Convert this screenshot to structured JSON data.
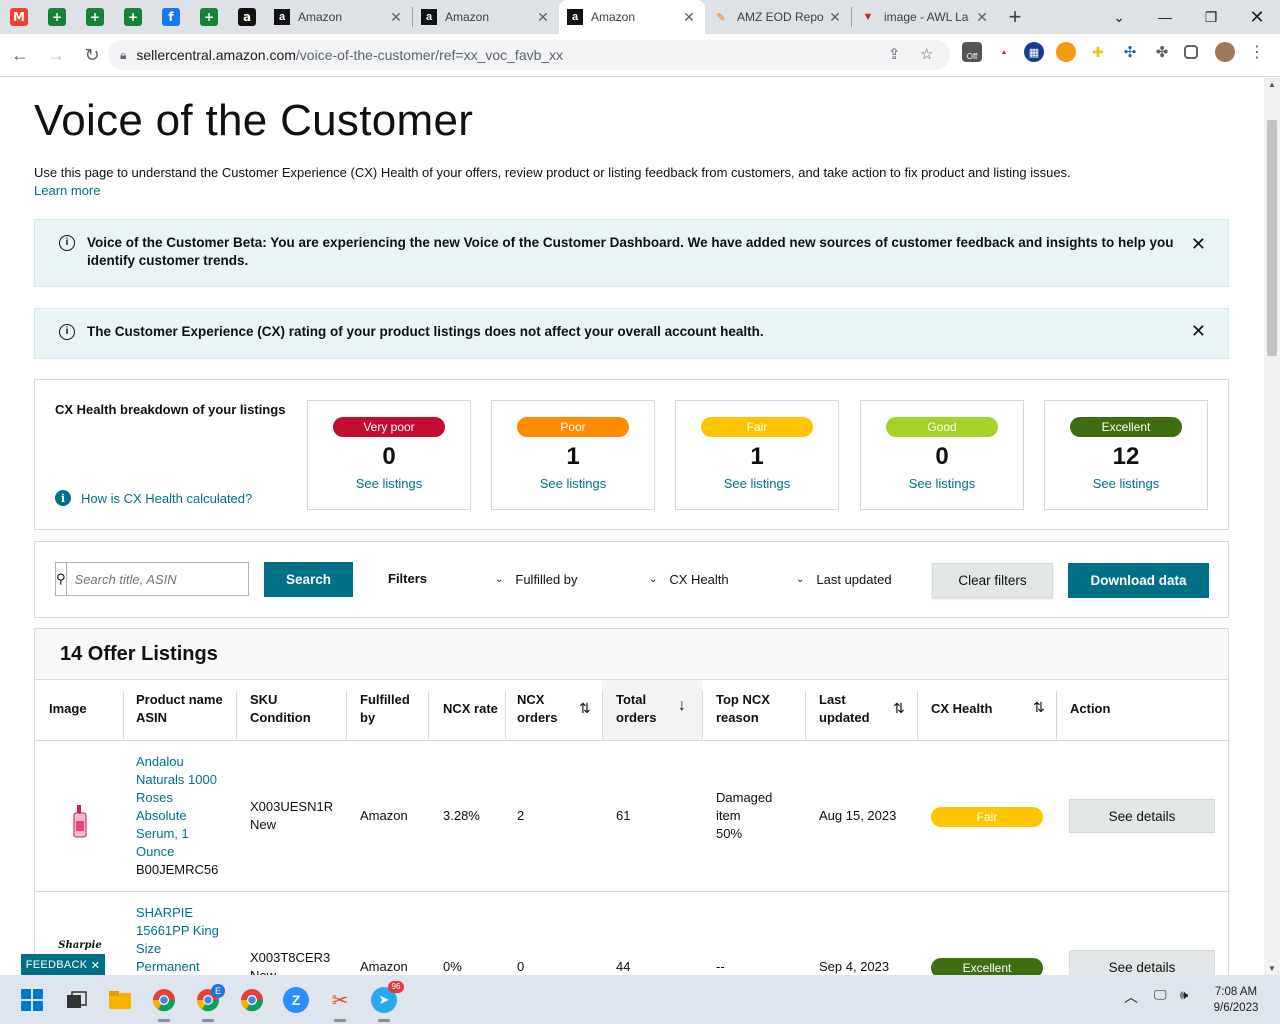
{
  "browser": {
    "pinned_tabs": [
      {
        "name": "gmail-icon",
        "glyph": "M",
        "color": "#ea4335"
      },
      {
        "name": "sheets-icon",
        "glyph": "+",
        "color": "#188038"
      },
      {
        "name": "sheets-icon",
        "glyph": "+",
        "color": "#188038"
      },
      {
        "name": "sheets-icon",
        "glyph": "+",
        "color": "#188038"
      },
      {
        "name": "facebook-icon",
        "glyph": "f",
        "color": "#1877f2"
      },
      {
        "name": "sheets-icon",
        "glyph": "+",
        "color": "#188038"
      },
      {
        "name": "amazon-icon",
        "glyph": "a",
        "color": "#111111"
      }
    ],
    "tabs": [
      {
        "title": "Amazon",
        "active": false
      },
      {
        "title": "Amazon",
        "active": false
      },
      {
        "title": "Amazon",
        "active": true
      },
      {
        "title": "AMZ EOD Repo",
        "active": false
      },
      {
        "title": "image - AWL La",
        "active": false
      }
    ],
    "url_host": "sellercentral.amazon.com",
    "url_path": "/voice-of-the-customer/ref=xx_voc_favb_xx",
    "ext_badge": "Off"
  },
  "page": {
    "title": "Voice of the Customer",
    "description": "Use this page to understand the Customer Experience (CX) Health of your offers, review product or listing feedback from customers, and take action to fix product and listing issues.",
    "learn_more": "Learn more",
    "alert_beta": "Voice of the Customer Beta: You are experiencing the new Voice of the Customer Dashboard. We have added new sources of customer feedback and insights to help you identify customer trends.",
    "alert_rating": "The Customer Experience (CX) rating of your product listings does not affect your overall account health."
  },
  "cx_health": {
    "title": "CX Health breakdown of your listings",
    "help_link": "How is CX Health calculated?",
    "cards": [
      {
        "label": "Very poor",
        "count": "0",
        "link": "See listings",
        "color": "#c40c33",
        "text": "#ffffff"
      },
      {
        "label": "Poor",
        "count": "1",
        "link": "See listings",
        "color": "#ff8c00",
        "text": "#ffffff"
      },
      {
        "label": "Fair",
        "count": "1",
        "link": "See listings",
        "color": "#ffc400",
        "text": "#ffffff"
      },
      {
        "label": "Good",
        "count": "0",
        "link": "See listings",
        "color": "#a4d22a",
        "text": "#ffffff"
      },
      {
        "label": "Excellent",
        "count": "12",
        "link": "See listings",
        "color": "#3f6d12",
        "text": "#ffffff"
      }
    ]
  },
  "filters": {
    "search_placeholder": "Search title, ASIN",
    "search_button": "Search",
    "filters_label": "Filters",
    "fulfilled_by": "Fulfilled by",
    "cx_health": "CX Health",
    "last_updated": "Last updated",
    "clear": "Clear filters",
    "download": "Download data"
  },
  "listings": {
    "heading": "14 Offer Listings",
    "columns": {
      "image": "Image",
      "product_1": "Product name",
      "product_2": "ASIN",
      "sku_1": "SKU",
      "sku_2": "Condition",
      "fulfilled_1": "Fulfilled",
      "fulfilled_2": "by",
      "ncx_rate": "NCX rate",
      "ncx_orders_1": "NCX",
      "ncx_orders_2": "orders",
      "total_1": "Total",
      "total_2": "orders",
      "top_1": "Top NCX",
      "top_2": "reason",
      "last_1": "Last",
      "last_2": "updated",
      "cx_health": "CX Health",
      "action": "Action"
    },
    "rows": [
      {
        "product_lines": [
          "Andalou",
          "Naturals 1000",
          "Roses",
          "Absolute",
          "Serum, 1",
          "Ounce"
        ],
        "asin": "B00JEMRC56",
        "sku": "X003UESN1R",
        "condition": "New",
        "fulfilled": "Amazon",
        "ncx_rate": "3.28%",
        "ncx_orders": "2",
        "total_orders": "61",
        "reason_1": "Damaged",
        "reason_2": "item",
        "reason_3": "50%",
        "updated": "Aug 15, 2023",
        "health": "Fair",
        "health_color": "#ffc400",
        "action": "See details"
      },
      {
        "product_lines": [
          "SHARPIE",
          "15661PP King",
          "Size",
          "Permanent"
        ],
        "sku": "X003T8CER3",
        "condition": "New",
        "fulfilled": "Amazon",
        "ncx_rate": "0%",
        "ncx_orders": "0",
        "total_orders": "44",
        "reason_1": "--",
        "updated": "Sep 4, 2023",
        "health": "Excellent",
        "health_color": "#3f6d12",
        "action": "See details"
      }
    ]
  },
  "feedback_label": "FEEDBACK",
  "taskbar": {
    "time": "7:08 AM",
    "date": "9/6/2023",
    "telegram_badge": "96",
    "profile_badge": "E"
  }
}
